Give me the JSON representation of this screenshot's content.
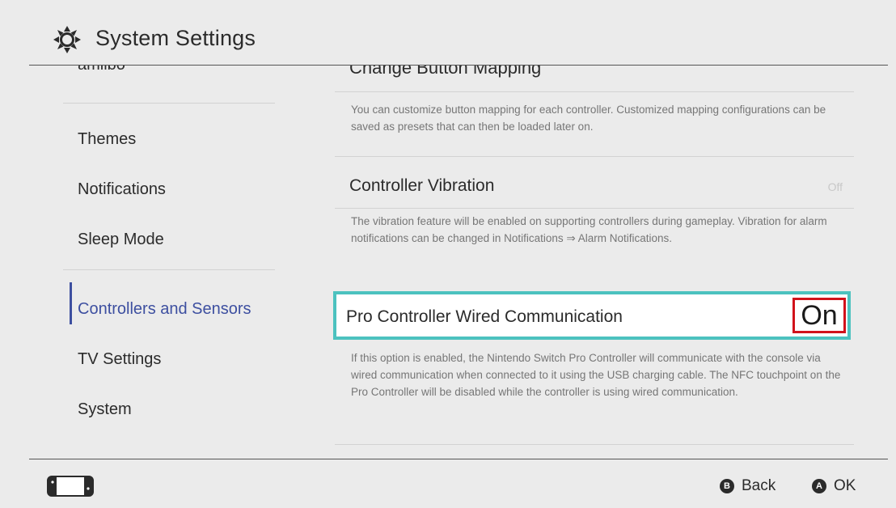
{
  "header": {
    "title": "System Settings",
    "icon": "gear-icon"
  },
  "sidebar": {
    "cut_item": "amiibo",
    "items": [
      {
        "label": "Themes"
      },
      {
        "label": "Notifications"
      },
      {
        "label": "Sleep Mode"
      },
      {
        "label": "Controllers and Sensors",
        "active": true
      },
      {
        "label": "TV Settings"
      },
      {
        "label": "System"
      }
    ]
  },
  "content": {
    "cut_option": "Change Button Mapping",
    "options": [
      {
        "description": "You can customize button mapping for each controller. Customized mapping configurations can be saved as presets that can then be loaded later on."
      },
      {
        "label": "Controller Vibration",
        "value": "Off",
        "description": "The vibration feature will be enabled on supporting controllers during gameplay. Vibration for alarm notifications can be changed in Notifications ⇒ Alarm Notifications."
      },
      {
        "label": "Pro Controller Wired Communication",
        "value": "On",
        "selected": true,
        "description": "If this option is enabled, the Nintendo Switch Pro Controller will communicate with the console via wired communication when connected to it using the USB charging cable. The NFC touchpoint on the Pro Controller will be disabled while the controller is using wired communication."
      }
    ]
  },
  "footer": {
    "console_icon": "handheld-console-icon",
    "back_button_key": "B",
    "back_label": "Back",
    "ok_button_key": "A",
    "ok_label": "OK"
  },
  "colors": {
    "accent_selection": "#4cc2bf",
    "active_item": "#3d4fa0",
    "highlight_box": "#d1121b",
    "background": "#ebebeb"
  }
}
